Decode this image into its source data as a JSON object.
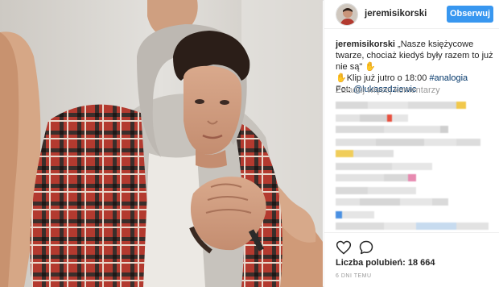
{
  "post": {
    "username": "jeremisikorski",
    "follow_label": "Obserwuj"
  },
  "caption": {
    "username": "jeremisikorski",
    "text_1": " „Nasze księżycowe twarze, chociaż kiedyś były razem to już nie są\"",
    "emoji_1": "✋",
    "emoji_2": "✋",
    "text_2": "Klip już jutro o 18:00 ",
    "hashtag": "#analogia",
    "photo_credit_label": "Fot: ",
    "mention": "@lukaszdziewic"
  },
  "comments": {
    "load_more": "Załaduj więcej komentarzy"
  },
  "actions": {
    "like_icon": "heart-outline-icon",
    "comment_icon": "speech-bubble-icon"
  },
  "stats": {
    "likes": "Liczba polubień: 18 664",
    "time_ago": "6 DNI TEMU"
  },
  "colors": {
    "follow_button": "#3897f0",
    "link": "#003569",
    "muted": "#999999"
  }
}
